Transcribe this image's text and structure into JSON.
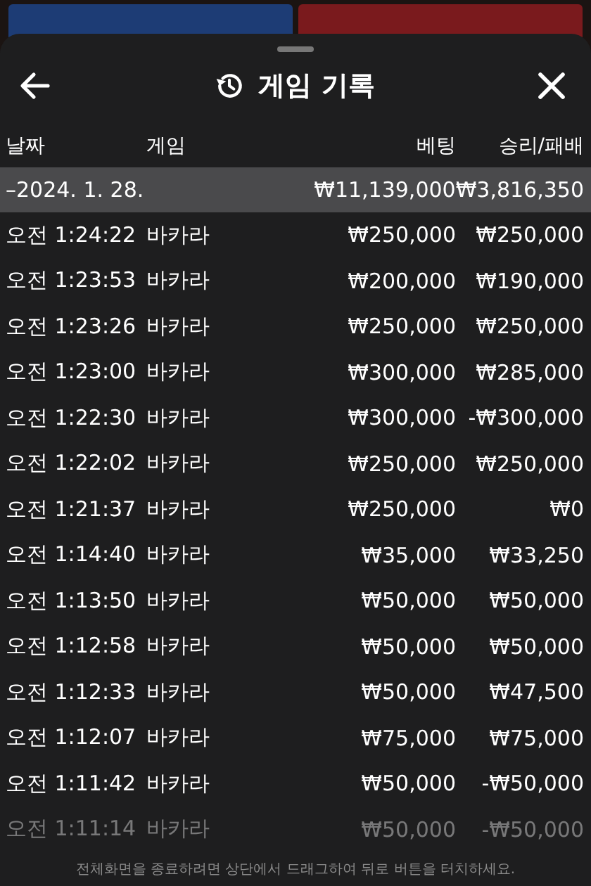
{
  "sheet": {
    "title": "게임 기록"
  },
  "columns": [
    "날짜",
    "게임",
    "베팅",
    "승리/패배"
  ],
  "summary": {
    "date": "–2024. 1. 28.",
    "bet": "₩11,139,000",
    "result": "₩3,816,350"
  },
  "rows": [
    {
      "time": "오전 1:24:22",
      "game": "바카라",
      "bet": "₩250,000",
      "result": "₩250,000",
      "dimmed": false
    },
    {
      "time": "오전 1:23:53",
      "game": "바카라",
      "bet": "₩200,000",
      "result": "₩190,000",
      "dimmed": false
    },
    {
      "time": "오전 1:23:26",
      "game": "바카라",
      "bet": "₩250,000",
      "result": "₩250,000",
      "dimmed": false
    },
    {
      "time": "오전 1:23:00",
      "game": "바카라",
      "bet": "₩300,000",
      "result": "₩285,000",
      "dimmed": false
    },
    {
      "time": "오전 1:22:30",
      "game": "바카라",
      "bet": "₩300,000",
      "result": "-₩300,000",
      "dimmed": false
    },
    {
      "time": "오전 1:22:02",
      "game": "바카라",
      "bet": "₩250,000",
      "result": "₩250,000",
      "dimmed": false
    },
    {
      "time": "오전 1:21:37",
      "game": "바카라",
      "bet": "₩250,000",
      "result": "₩0",
      "dimmed": false
    },
    {
      "time": "오전 1:14:40",
      "game": "바카라",
      "bet": "₩35,000",
      "result": "₩33,250",
      "dimmed": false
    },
    {
      "time": "오전 1:13:50",
      "game": "바카라",
      "bet": "₩50,000",
      "result": "₩50,000",
      "dimmed": false
    },
    {
      "time": "오전 1:12:58",
      "game": "바카라",
      "bet": "₩50,000",
      "result": "₩50,000",
      "dimmed": false
    },
    {
      "time": "오전 1:12:33",
      "game": "바카라",
      "bet": "₩50,000",
      "result": "₩47,500",
      "dimmed": false
    },
    {
      "time": "오전 1:12:07",
      "game": "바카라",
      "bet": "₩75,000",
      "result": "₩75,000",
      "dimmed": false
    },
    {
      "time": "오전 1:11:42",
      "game": "바카라",
      "bet": "₩50,000",
      "result": "-₩50,000",
      "dimmed": false
    },
    {
      "time": "오전 1:11:14",
      "game": "바카라",
      "bet": "₩50,000",
      "result": "-₩50,000",
      "dimmed": true
    }
  ],
  "toast": {
    "text": "전체화면을 종료하려면 상단에서 드래그하여 뒤로 버튼을 터치하세요."
  }
}
